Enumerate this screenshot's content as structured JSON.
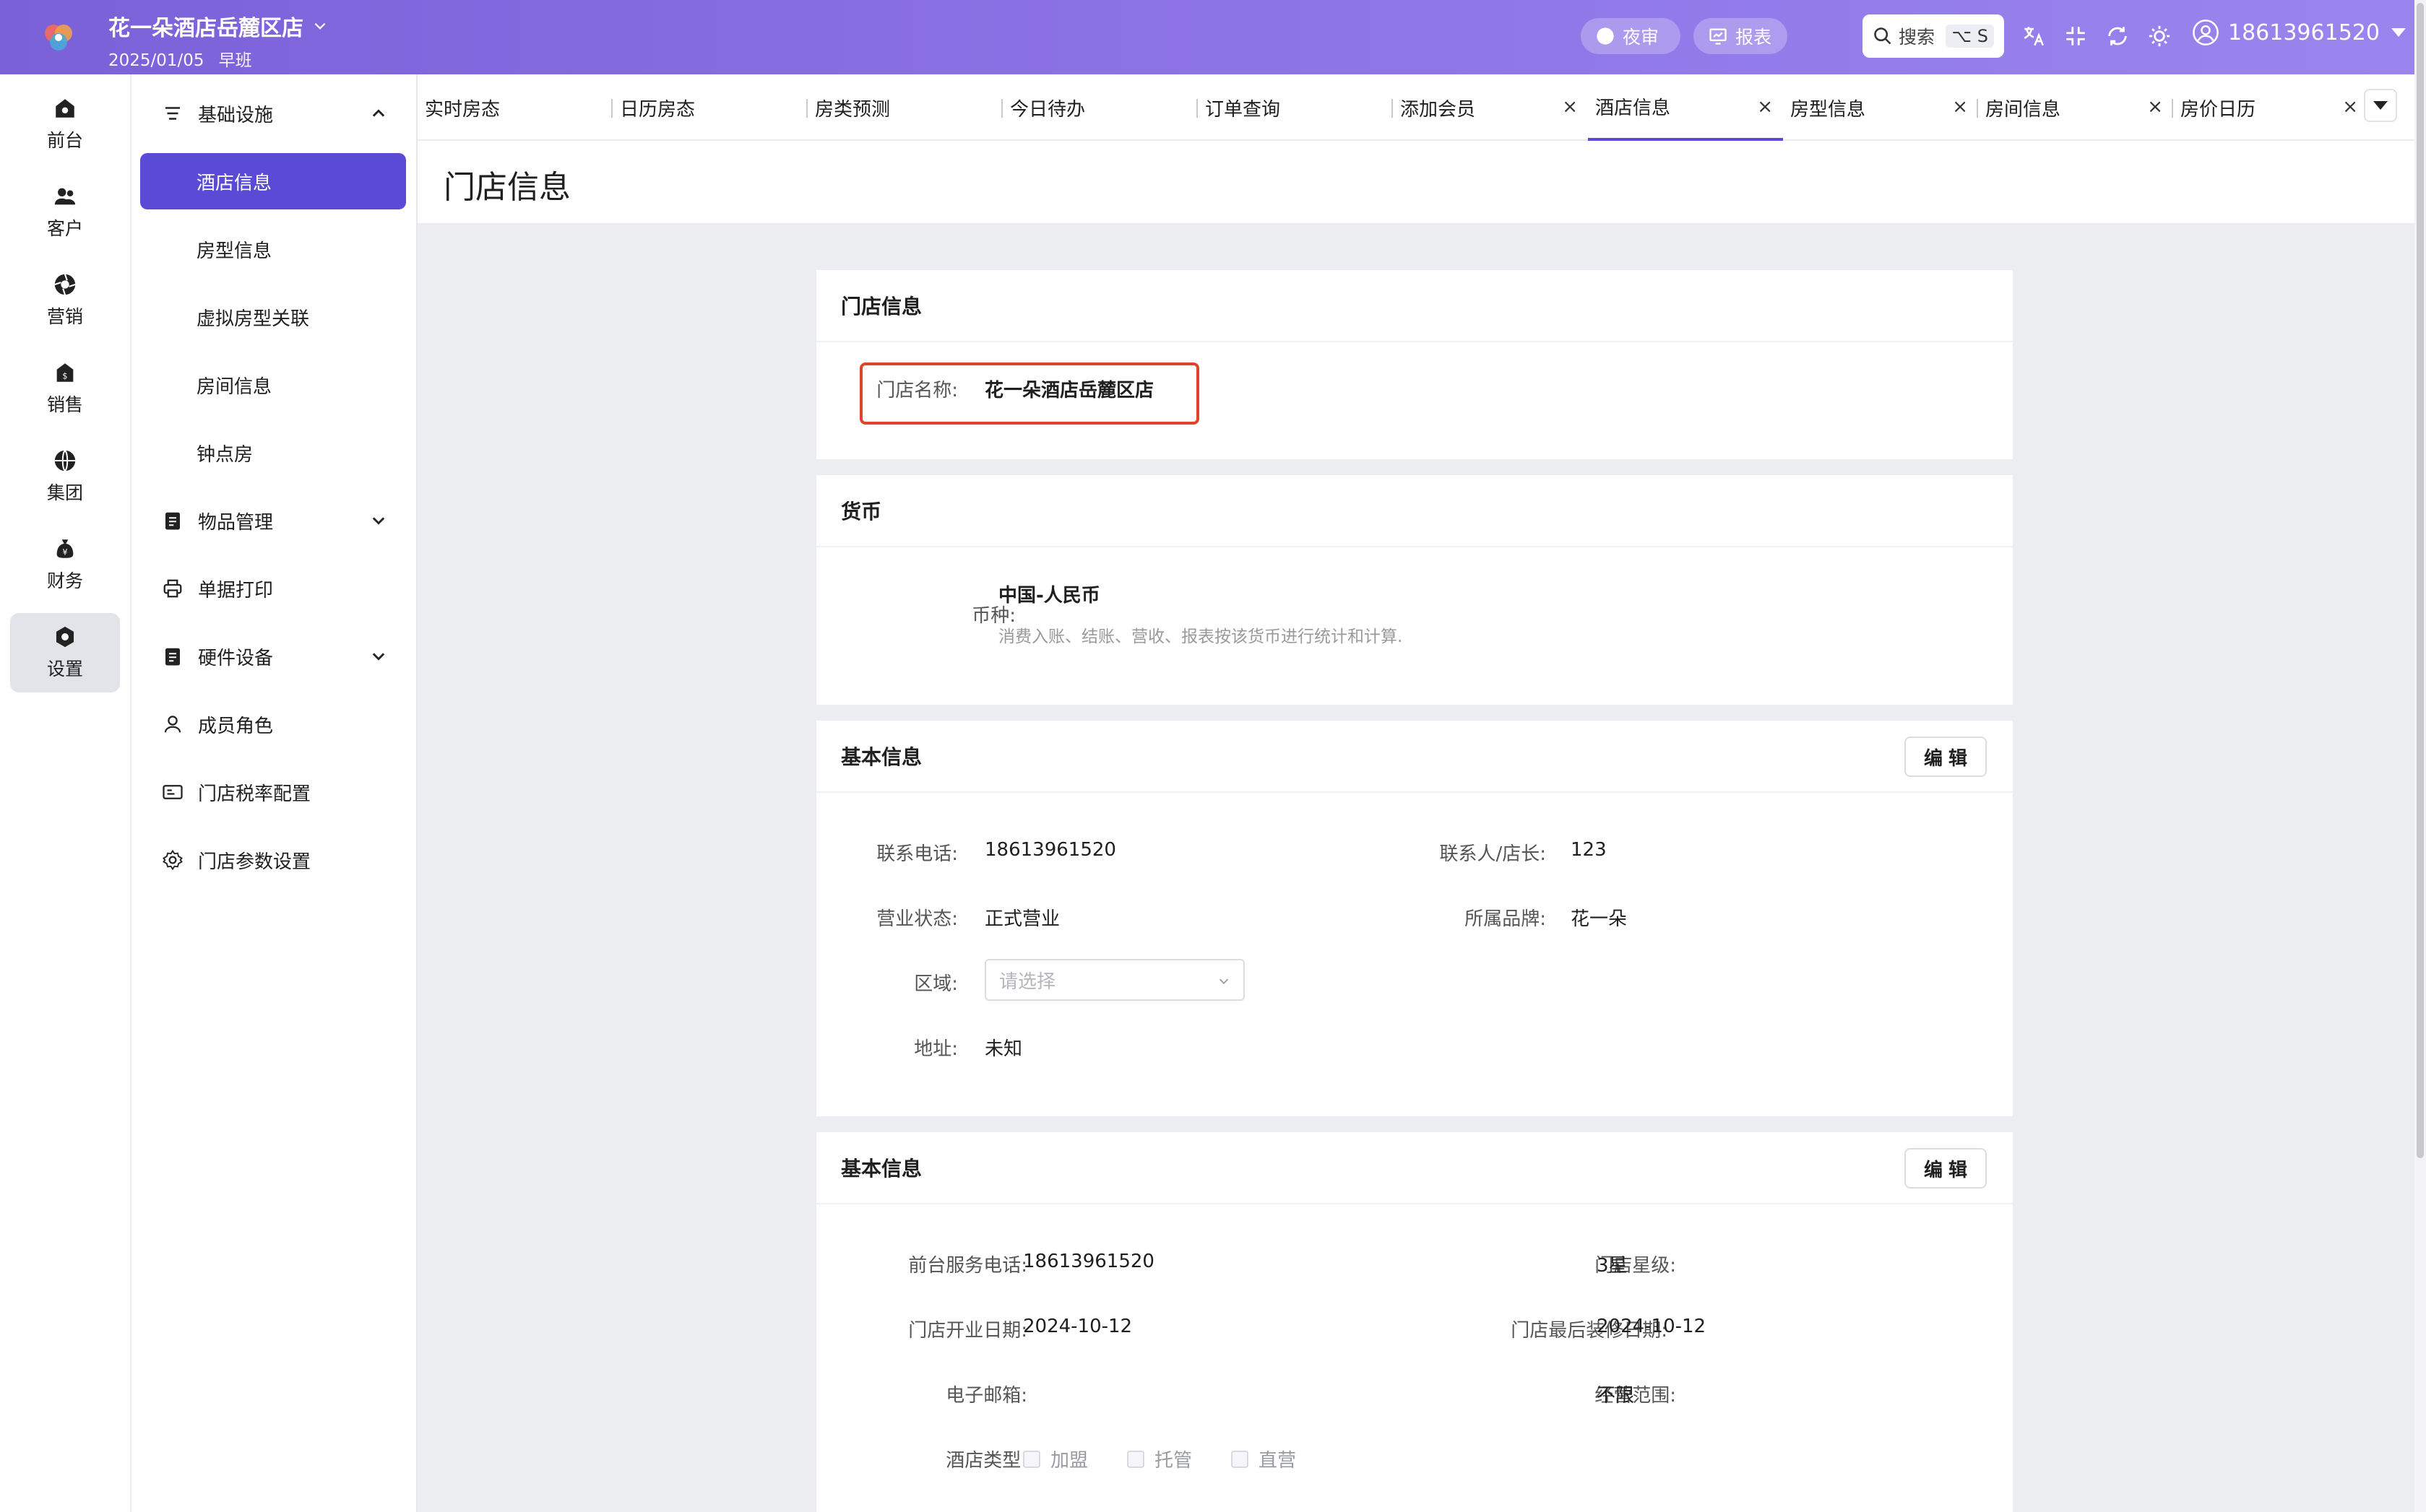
{
  "header": {
    "hotel_name": "花一朵酒店岳麓区店",
    "date": "2025/01/05",
    "shift": "早班",
    "night_audit": "夜审",
    "report": "报表",
    "search_label": "搜索",
    "search_shortcut": "⌥ S",
    "username": "18613961520"
  },
  "rail": {
    "items": [
      {
        "label": "前台",
        "icon": "home-icon"
      },
      {
        "label": "客户",
        "icon": "users-icon"
      },
      {
        "label": "营销",
        "icon": "aperture-icon"
      },
      {
        "label": "销售",
        "icon": "sales-icon"
      },
      {
        "label": "集团",
        "icon": "globe-icon"
      },
      {
        "label": "财务",
        "icon": "money-bag-icon"
      },
      {
        "label": "设置",
        "icon": "settings-icon"
      }
    ],
    "active": "设置"
  },
  "submenu": {
    "group1": "基础设施",
    "children": [
      "酒店信息",
      "房型信息",
      "虚拟房型关联",
      "房间信息",
      "钟点房"
    ],
    "items_mgmt": "物品管理",
    "print": "单据打印",
    "hardware": "硬件设备",
    "roles": "成员角色",
    "tax": "门店税率配置",
    "params": "门店参数设置"
  },
  "tabs": [
    {
      "label": "实时房态",
      "closable": false
    },
    {
      "label": "日历房态",
      "closable": false
    },
    {
      "label": "房类预测",
      "closable": false
    },
    {
      "label": "今日待办",
      "closable": false
    },
    {
      "label": "订单查询",
      "closable": false
    },
    {
      "label": "添加会员",
      "closable": true
    },
    {
      "label": "酒店信息",
      "closable": true,
      "active": true
    },
    {
      "label": "房型信息",
      "closable": true
    },
    {
      "label": "房间信息",
      "closable": true
    },
    {
      "label": "房价日历",
      "closable": true
    }
  ],
  "tab_close_glyph": "×",
  "page": {
    "title": "门店信息"
  },
  "store_card": {
    "title": "门店信息",
    "name_label": "门店名称:",
    "name_value": "花一朵酒店岳麓区店"
  },
  "currency_card": {
    "title": "货币",
    "label": "币种:",
    "value": "中国-人民币",
    "hint": "消费入账、结账、营收、报表按该货币进行统计和计算."
  },
  "basic_card": {
    "title": "基本信息",
    "edit": "编辑",
    "phone_label": "联系电话:",
    "phone": "18613961520",
    "contact_label": "联系人/店长:",
    "contact": "123",
    "status_label": "营业状态:",
    "status": "正式营业",
    "brand_label": "所属品牌:",
    "brand": "花一朵",
    "region_label": "区域:",
    "region_placeholder": "请选择",
    "address_label": "地址:",
    "address": "未知"
  },
  "basic_card2": {
    "title": "基本信息",
    "edit": "编辑",
    "front_phone_label": "前台服务电话:",
    "front_phone": "18613961520",
    "star_label": "门店星级:",
    "star": "3星",
    "open_label": "门店开业日期:",
    "open_date": "2024-10-12",
    "renov_label": "门店最后装修日期:",
    "renov_date": "2024-10-12",
    "email_label": "电子邮箱:",
    "email": "",
    "scope_label": "经营范围:",
    "scope": "不限",
    "type_label": "酒店类型:",
    "types": [
      "加盟",
      "托管",
      "直营"
    ]
  }
}
